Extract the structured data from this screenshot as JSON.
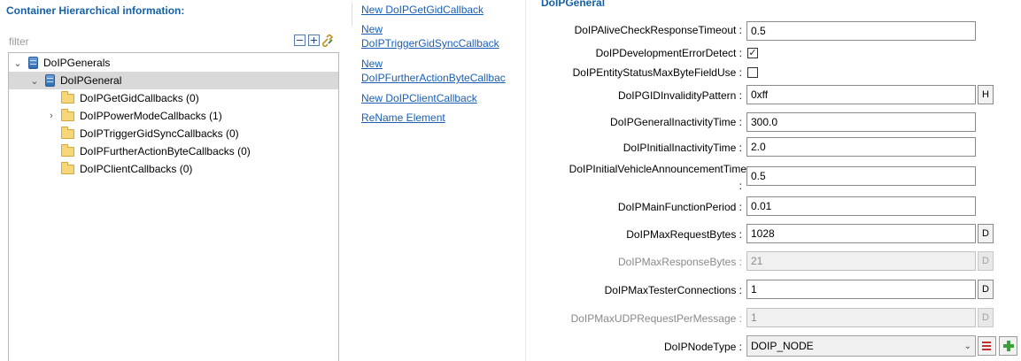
{
  "left_panel": {
    "title": "Container Hierarchical information:",
    "filter_label": "filter",
    "tree": [
      {
        "label": "DoIPGenerals",
        "twisty": "⌄",
        "icon": "database-icon"
      },
      {
        "label": "DoIPGeneral",
        "twisty": "⌄",
        "icon": "database-icon",
        "selected": true
      },
      {
        "label": "DoIPGetGidCallbacks (0)",
        "twisty": "",
        "icon": "folder-icon"
      },
      {
        "label": "DoIPPowerModeCallbacks (1)",
        "twisty": "›",
        "icon": "folder-icon"
      },
      {
        "label": "DoIPTriggerGidSyncCallbacks (0)",
        "twisty": "",
        "icon": "folder-icon"
      },
      {
        "label": "DoIPFurtherActionByteCallbacks (0)",
        "twisty": "",
        "icon": "folder-icon"
      },
      {
        "label": "DoIPClientCallbacks (0)",
        "twisty": "",
        "icon": "folder-icon"
      }
    ]
  },
  "links": [
    {
      "line1": "New DoIPGetGidCallback",
      "line2": ""
    },
    {
      "line1": "New",
      "line2": "DoIPTriggerGidSyncCallback"
    },
    {
      "line1": "New",
      "line2": "DoIPFurtherActionByteCallbac"
    },
    {
      "line1": "New DoIPClientCallback",
      "line2": ""
    },
    {
      "line1": "ReName Element",
      "line2": ""
    }
  ],
  "form": {
    "title": "DoIPGeneral",
    "fields": {
      "alive_check_timeout": {
        "label": "DoIPAliveCheckResponseTimeout :",
        "value": "0.5"
      },
      "dev_error_detect": {
        "label": "DoIPDevelopmentErrorDetect :",
        "checked": "✓"
      },
      "entity_status_max": {
        "label": "DoIPEntityStatusMaxByteFieldUse :",
        "checked": ""
      },
      "gid_invalidity": {
        "label": "DoIPGIDInvalidityPattern :",
        "value": "0xff",
        "button": "H"
      },
      "general_inactivity": {
        "label": "DoIPGeneralInactivityTime :",
        "value": "300.0"
      },
      "initial_inactivity": {
        "label": "DoIPInitialInactivityTime :",
        "value": "2.0"
      },
      "initial_vehicle_announcement": {
        "label_line1": "DoIPInitialVehicleAnnouncementTime",
        "label_line2": ":",
        "value": "0.5"
      },
      "main_function_period": {
        "label": "DoIPMainFunctionPeriod :",
        "value": "0.01"
      },
      "max_request_bytes": {
        "label": "DoIPMaxRequestBytes :",
        "value": "1028",
        "button": "D"
      },
      "max_response_bytes": {
        "label": "DoIPMaxResponseBytes :",
        "value": "21",
        "button": "D"
      },
      "max_tester_connections": {
        "label": "DoIPMaxTesterConnections :",
        "value": "1",
        "button": "D"
      },
      "max_udp_request": {
        "label": "DoIPMaxUDPRequestPerMessage :",
        "value": "1",
        "button": "D"
      },
      "node_type": {
        "label": "DoIPNodeType :",
        "value": "DOIP_NODE"
      }
    }
  }
}
